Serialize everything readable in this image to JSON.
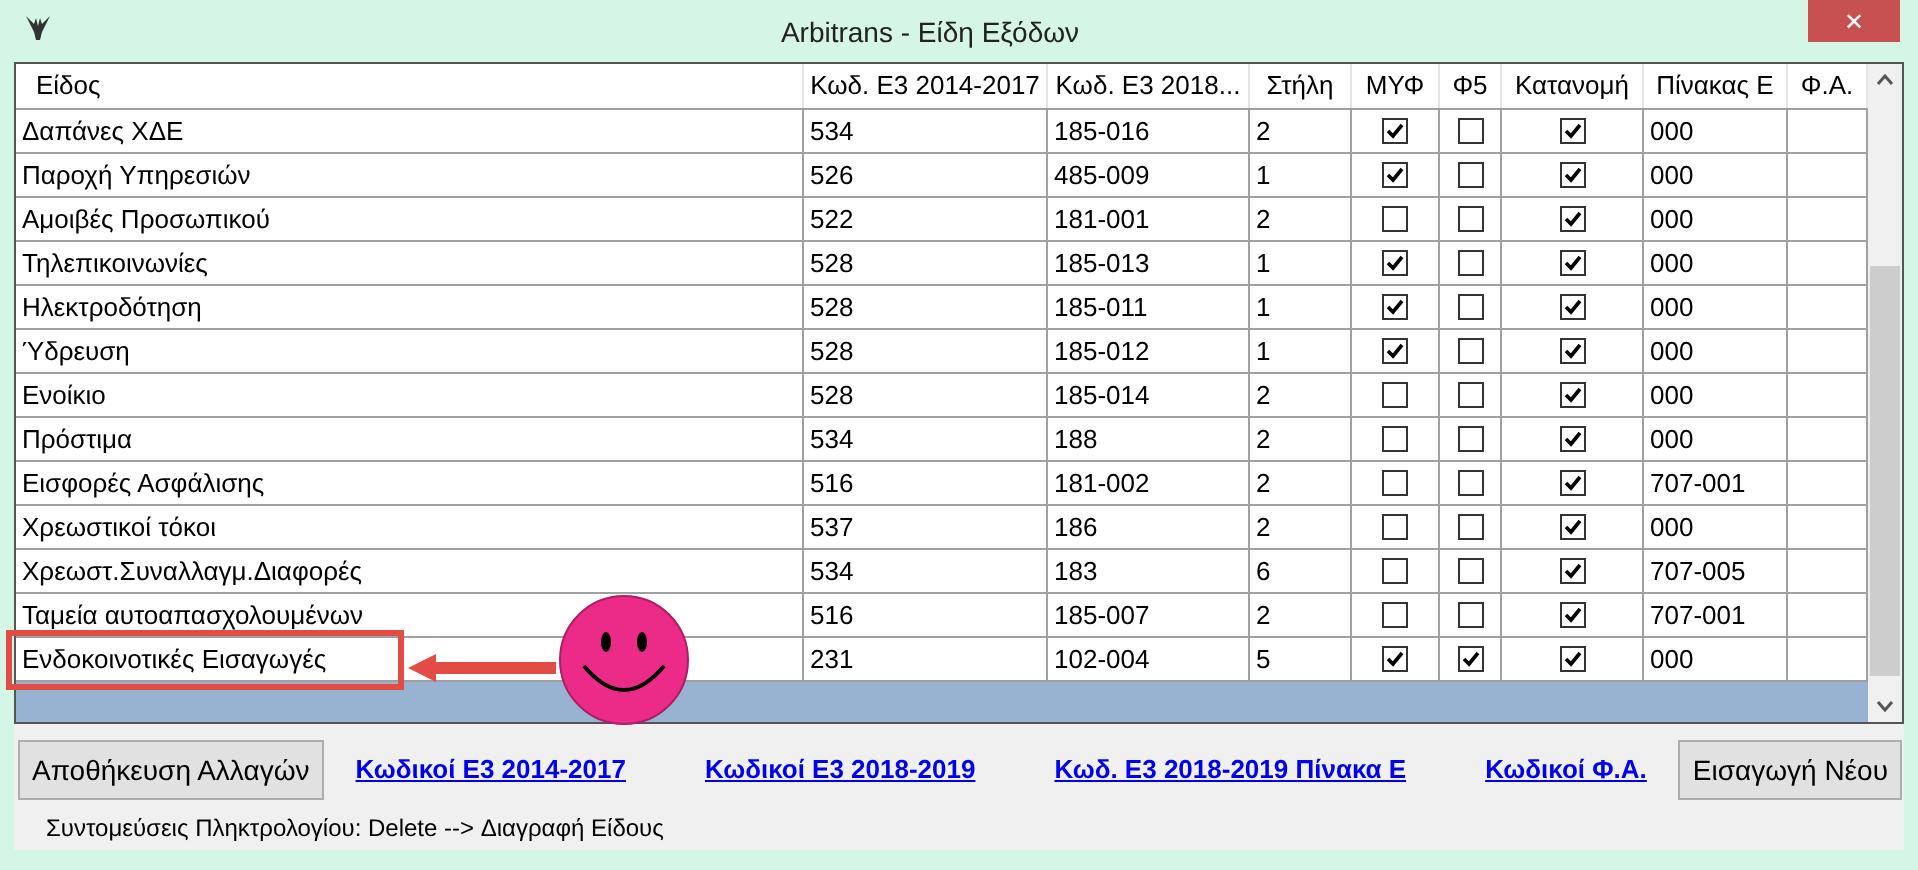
{
  "window": {
    "title": "Arbitrans - Είδη Εξόδων",
    "close": "✕"
  },
  "table": {
    "columns": [
      {
        "label": "Είδος",
        "kind": "text"
      },
      {
        "label": "Κωδ. Ε3 2014-2017",
        "kind": "text"
      },
      {
        "label": "Κωδ. Ε3 2018...",
        "kind": "text"
      },
      {
        "label": "Στήλη",
        "kind": "text"
      },
      {
        "label": "ΜΥΦ",
        "kind": "check"
      },
      {
        "label": "Φ5",
        "kind": "check"
      },
      {
        "label": "Κατανομή",
        "kind": "check"
      },
      {
        "label": "Πίνακας Ε",
        "kind": "text"
      },
      {
        "label": "Φ.Α.",
        "kind": "text"
      }
    ],
    "rows": [
      {
        "annotated": false,
        "cells": [
          "Δαπάνες ΧΔΕ",
          "534",
          "185-016",
          "2",
          {
            "checked": true
          },
          {
            "checked": false
          },
          {
            "checked": true
          },
          "000"
        ]
      },
      {
        "annotated": false,
        "cells": [
          "Παροχή Υπηρεσιών",
          "526",
          "485-009",
          "1",
          {
            "checked": true
          },
          {
            "checked": false
          },
          {
            "checked": true
          },
          "000"
        ]
      },
      {
        "annotated": false,
        "cells": [
          "Αμοιβές Προσωπικού",
          "522",
          "181-001",
          "2",
          {
            "checked": false
          },
          {
            "checked": false
          },
          {
            "checked": true
          },
          "000"
        ]
      },
      {
        "annotated": false,
        "cells": [
          "Τηλεπικοινωνίες",
          "528",
          "185-013",
          "1",
          {
            "checked": true
          },
          {
            "checked": false
          },
          {
            "checked": true
          },
          "000"
        ]
      },
      {
        "annotated": false,
        "cells": [
          "Ηλεκτροδότηση",
          "528",
          "185-011",
          "1",
          {
            "checked": true
          },
          {
            "checked": false
          },
          {
            "checked": true
          },
          "000"
        ]
      },
      {
        "annotated": false,
        "cells": [
          "Ύδρευση",
          "528",
          "185-012",
          "1",
          {
            "checked": true
          },
          {
            "checked": false
          },
          {
            "checked": true
          },
          "000"
        ]
      },
      {
        "annotated": false,
        "cells": [
          "Ενοίκιο",
          "528",
          "185-014",
          "2",
          {
            "checked": false
          },
          {
            "checked": false
          },
          {
            "checked": true
          },
          "000"
        ]
      },
      {
        "annotated": false,
        "cells": [
          "Πρόστιμα",
          "534",
          "188",
          "2",
          {
            "checked": false
          },
          {
            "checked": false
          },
          {
            "checked": true
          },
          "000"
        ]
      },
      {
        "annotated": false,
        "cells": [
          "Εισφορές Ασφάλισης",
          "516",
          "181-002",
          "2",
          {
            "checked": false
          },
          {
            "checked": false
          },
          {
            "checked": true
          },
          "707-001"
        ]
      },
      {
        "annotated": false,
        "cells": [
          "Χρεωστικοί τόκοι",
          "537",
          "186",
          "2",
          {
            "checked": false
          },
          {
            "checked": false
          },
          {
            "checked": true
          },
          "000"
        ]
      },
      {
        "annotated": false,
        "cells": [
          "Χρεωστ.Συναλλαγμ.Διαφορές",
          "534",
          "183",
          "6",
          {
            "checked": false
          },
          {
            "checked": false
          },
          {
            "checked": true
          },
          "707-005"
        ]
      },
      {
        "annotated": false,
        "cells": [
          "Ταμεία αυτοαπασχολουμένων",
          "516",
          "185-007",
          "2",
          {
            "checked": false
          },
          {
            "checked": false
          },
          {
            "checked": true
          },
          "707-001"
        ]
      },
      {
        "annotated": true,
        "cells": [
          "Ενδοκοινοτικές Εισαγωγές",
          "231",
          "102-004",
          "5",
          {
            "checked": true
          },
          {
            "checked": true
          },
          {
            "checked": true
          },
          "000"
        ]
      }
    ]
  },
  "save_button": "Αποθήκευση Αλλαγών",
  "links": [
    "Κωδικοί Ε3 2014-2017",
    "Κωδικοί Ε3 2018-2019",
    "Κωδ. Ε3 2018-2019 Πίνακα Ε",
    "Κωδικοί Φ.Α."
  ],
  "new_button": "Εισαγωγή Νέου",
  "shortcuts": "Συντομεύσεις Πληκτρολογίου: Delete --> Διαγραφή Είδους"
}
